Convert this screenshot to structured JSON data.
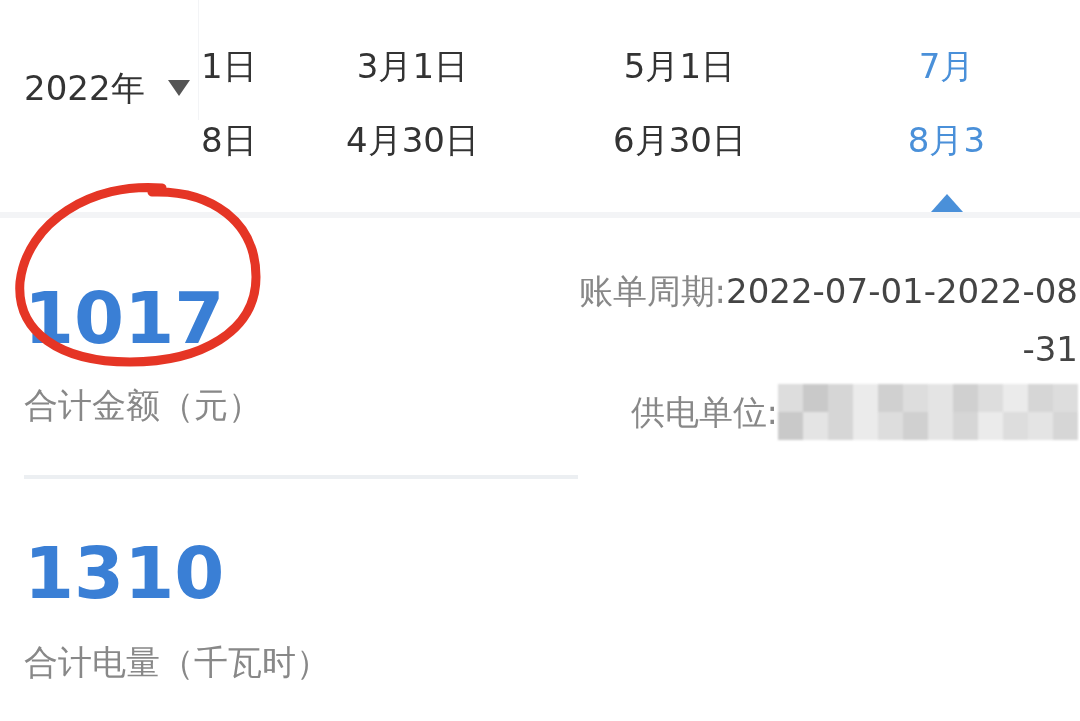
{
  "year_selector": {
    "label": "2022年"
  },
  "periods": [
    {
      "start": "1日",
      "end": "8日",
      "selected": false
    },
    {
      "start": "3月1日",
      "end": "4月30日",
      "selected": false
    },
    {
      "start": "5月1日",
      "end": "6月30日",
      "selected": false
    },
    {
      "start": "7月",
      "end": "8月3",
      "selected": true
    }
  ],
  "total_amount": {
    "value": "1017",
    "label": "合计金额（元）"
  },
  "bill_period": {
    "label": "账单周期:",
    "value": "2022-07-01-2022-08-31"
  },
  "supplier": {
    "label": "供电单位:"
  },
  "total_energy": {
    "value": "1310",
    "label": "合计电量（千瓦时）"
  }
}
